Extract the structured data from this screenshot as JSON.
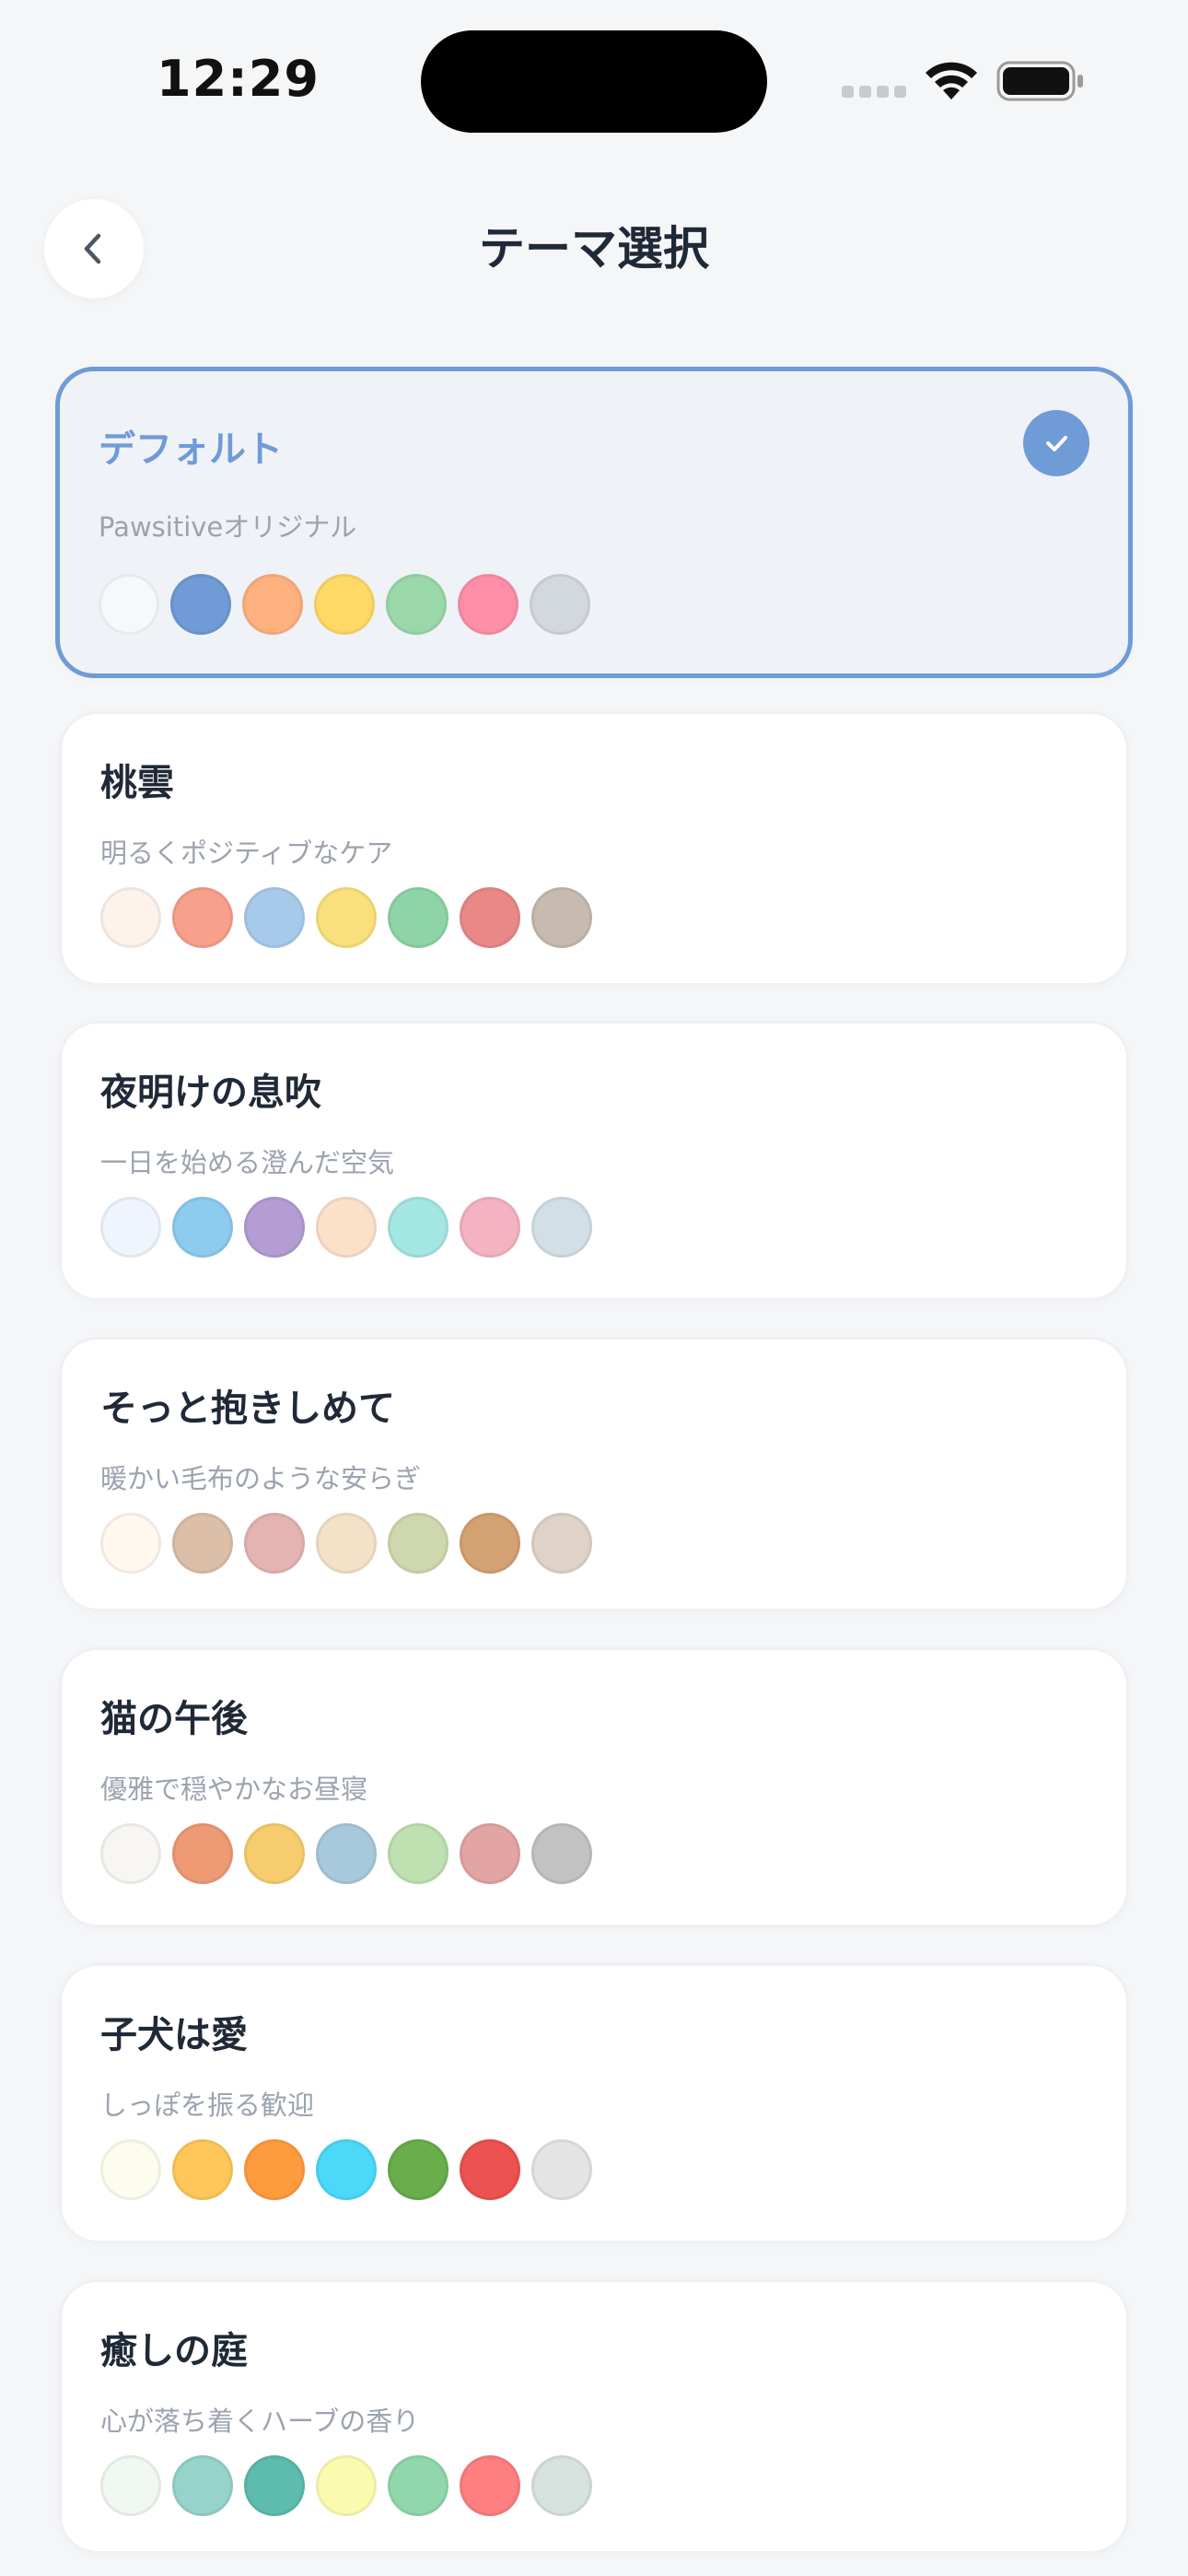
{
  "status_bar": {
    "time": "12:29"
  },
  "header": {
    "title": "テーマ選択"
  },
  "colors": {
    "accent": "#6F9BD6"
  },
  "themes": [
    {
      "name": "デフォルト",
      "description": "Pawsitiveオリジナル",
      "selected": true,
      "swatches": [
        "#F7F8FA",
        "#6F9BD6",
        "#FFB07F",
        "#FFD966",
        "#9BD8A9",
        "#FF8FA8",
        "#D2D8DE"
      ]
    },
    {
      "name": "桃雲",
      "description": "明るくポジティブなケア",
      "selected": false,
      "swatches": [
        "#FDF3EC",
        "#F7A08C",
        "#A7CAEA",
        "#F9E07C",
        "#8FD4A6",
        "#E98987",
        "#C7BAAE"
      ]
    },
    {
      "name": "夜明けの息吹",
      "description": "一日を始める澄んだ空気",
      "selected": false,
      "swatches": [
        "#EEF5FD",
        "#8DCBEF",
        "#B39DD3",
        "#FBE0CA",
        "#A4E6E2",
        "#F4B3C2",
        "#D3DFE6"
      ]
    },
    {
      "name": "そっと抱きしめて",
      "description": "暖かい毛布のような安らぎ",
      "selected": false,
      "swatches": [
        "#FFF8EF",
        "#DBBFA8",
        "#E4B4B2",
        "#F4E2C8",
        "#CFD7AE",
        "#D4A173",
        "#DFD3C8"
      ]
    },
    {
      "name": "猫の午後",
      "description": "優雅で穏やかなお昼寝",
      "selected": false,
      "swatches": [
        "#F7F6F3",
        "#EE9A75",
        "#F6CC6E",
        "#A8C8DB",
        "#BFE0B0",
        "#E3A4A4",
        "#C2C2C2"
      ]
    },
    {
      "name": "子犬は愛",
      "description": "しっぽを振る歓迎",
      "selected": false,
      "swatches": [
        "#FDFDEF",
        "#FFC759",
        "#FF9B3F",
        "#4CD8F8",
        "#68AE4B",
        "#EC524F",
        "#E4E4E4"
      ]
    },
    {
      "name": "癒しの庭",
      "description": "心が落ち着くハーブの香り",
      "selected": false,
      "swatches": [
        "#F1F7F1",
        "#95D3CB",
        "#5DBCAD",
        "#FBFBB0",
        "#90D8AC",
        "#FD7F7F",
        "#D7E2DE"
      ]
    }
  ]
}
